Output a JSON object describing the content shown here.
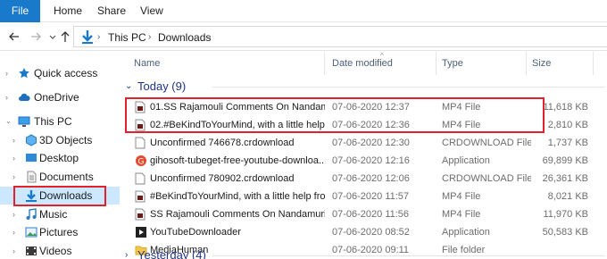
{
  "ribbon": {
    "tabs": [
      "File",
      "Home",
      "Share",
      "View"
    ]
  },
  "address": {
    "crumbs": [
      "This PC",
      "Downloads"
    ]
  },
  "nav": {
    "items": [
      {
        "label": "Quick access",
        "icon": "star-icon"
      },
      {
        "label": "OneDrive",
        "icon": "cloud-icon"
      },
      {
        "label": "This PC",
        "icon": "computer-icon"
      },
      {
        "label": "3D Objects",
        "icon": "cube-icon"
      },
      {
        "label": "Desktop",
        "icon": "desktop-icon"
      },
      {
        "label": "Documents",
        "icon": "document-icon"
      },
      {
        "label": "Downloads",
        "icon": "download-arrow-icon"
      },
      {
        "label": "Music",
        "icon": "music-icon"
      },
      {
        "label": "Pictures",
        "icon": "pictures-icon"
      },
      {
        "label": "Videos",
        "icon": "videos-icon"
      }
    ]
  },
  "columns": {
    "name": "Name",
    "date": "Date modified",
    "type": "Type",
    "size": "Size"
  },
  "groups": {
    "today": "Today (9)",
    "yesterday": "Yesterday (4)"
  },
  "files": [
    {
      "name": "01.SS Rajamouli Comments On Nandam...",
      "date": "07-06-2020 12:37",
      "type": "MP4 File",
      "size": "11,618 KB",
      "icon": "video-file-icon"
    },
    {
      "name": "02.#BeKindToYourMind, with a little help ...",
      "date": "07-06-2020 12:36",
      "type": "MP4 File",
      "size": "2,810 KB",
      "icon": "video-file-icon"
    },
    {
      "name": "Unconfirmed 746678.crdownload",
      "date": "07-06-2020 12:30",
      "type": "CRDOWNLOAD File",
      "size": "1,737 KB",
      "icon": "blank-file-icon"
    },
    {
      "name": "gihosoft-tubeget-free-youtube-downloa...",
      "date": "07-06-2020 12:16",
      "type": "Application",
      "size": "69,899 KB",
      "icon": "app-g-icon"
    },
    {
      "name": "Unconfirmed 780902.crdownload",
      "date": "07-06-2020 12:06",
      "type": "CRDOWNLOAD File",
      "size": "26,361 KB",
      "icon": "blank-file-icon"
    },
    {
      "name": "#BeKindToYourMind, with a little help fro...",
      "date": "07-06-2020 11:57",
      "type": "MP4 File",
      "size": "8,021 KB",
      "icon": "video-file-icon"
    },
    {
      "name": "SS Rajamouli Comments On Nandamuri ...",
      "date": "07-06-2020 11:56",
      "type": "MP4 File",
      "size": "11,970 KB",
      "icon": "video-file-icon"
    },
    {
      "name": "YouTubeDownloader",
      "date": "07-06-2020 08:52",
      "type": "Application",
      "size": "50,583 KB",
      "icon": "app-youtube-icon"
    },
    {
      "name": "MediaHuman",
      "date": "07-06-2020 09:11",
      "type": "File folder",
      "size": "",
      "icon": "folder-icon"
    }
  ],
  "colors": {
    "accent": "#1979ca",
    "selection": "#cce8ff",
    "highlight": "#e3212c",
    "group": "#1e3287"
  }
}
